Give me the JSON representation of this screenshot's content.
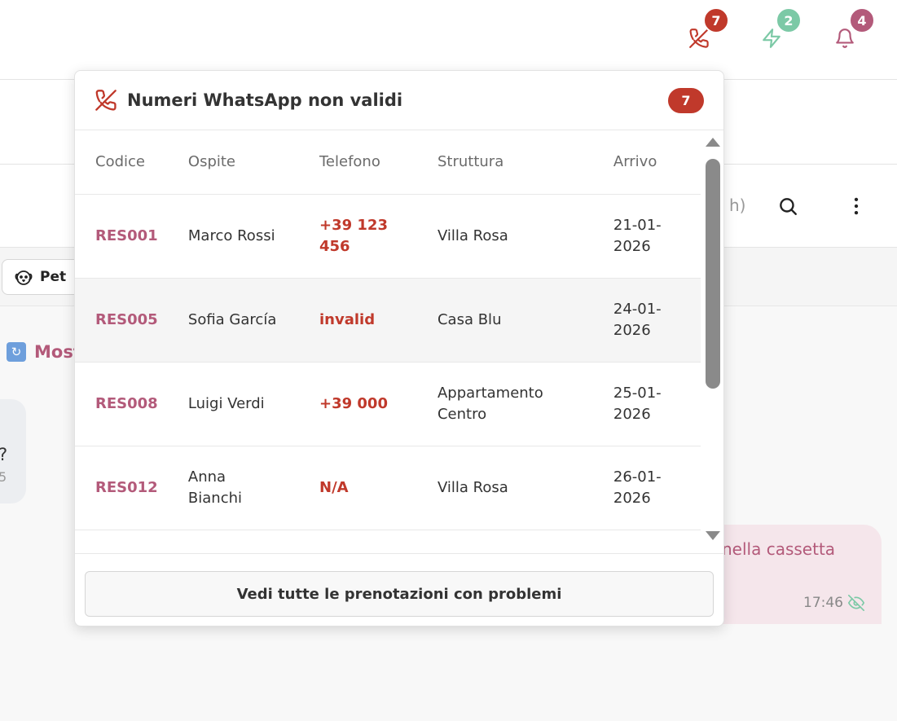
{
  "header": {
    "alerts": [
      {
        "name": "invalid-phone",
        "icon": "phone-off-icon",
        "count": "7",
        "badge_color": "#c0392b"
      },
      {
        "name": "zap",
        "icon": "lightning-icon",
        "count": "2",
        "badge_color": "#7cc9a6"
      },
      {
        "name": "notifications",
        "icon": "bell-icon",
        "count": "4",
        "badge_color": "#b35a7a"
      }
    ]
  },
  "toolbar": {
    "hint_text": "h)"
  },
  "filters": {
    "pet_label": "Pet"
  },
  "chat": {
    "show_more_label": "Most",
    "left_bubble_fragment": "?",
    "left_bubble_time_fragment": "5",
    "right_bubble_text": "nella cassetta",
    "right_bubble_time": "17:46"
  },
  "panel": {
    "title": "Numeri WhatsApp non validi",
    "count": "7",
    "columns": [
      "Codice",
      "Ospite",
      "Telefono",
      "Struttura",
      "Arrivo"
    ],
    "rows": [
      {
        "code": "RES001",
        "guest": "Marco Rossi",
        "phone": "+39 123 456",
        "property": "Villa Rosa",
        "arrival": "21-01-2026"
      },
      {
        "code": "RES005",
        "guest": "Sofia García",
        "phone": "invalid",
        "property": "Casa Blu",
        "arrival": "24-01-2026"
      },
      {
        "code": "RES008",
        "guest": "Luigi Verdi",
        "phone": "+39 000",
        "property": "Appartamento Centro",
        "arrival": "25-01-2026"
      },
      {
        "code": "RES012",
        "guest": "Anna Bianchi",
        "phone": "N/A",
        "property": "Villa Rosa",
        "arrival": "26-01-2026"
      }
    ],
    "footer_button": "Vedi tutte le prenotazioni con problemi"
  },
  "colors": {
    "accent": "#b35a7a",
    "danger": "#c0392b",
    "success": "#7cc9a6"
  }
}
